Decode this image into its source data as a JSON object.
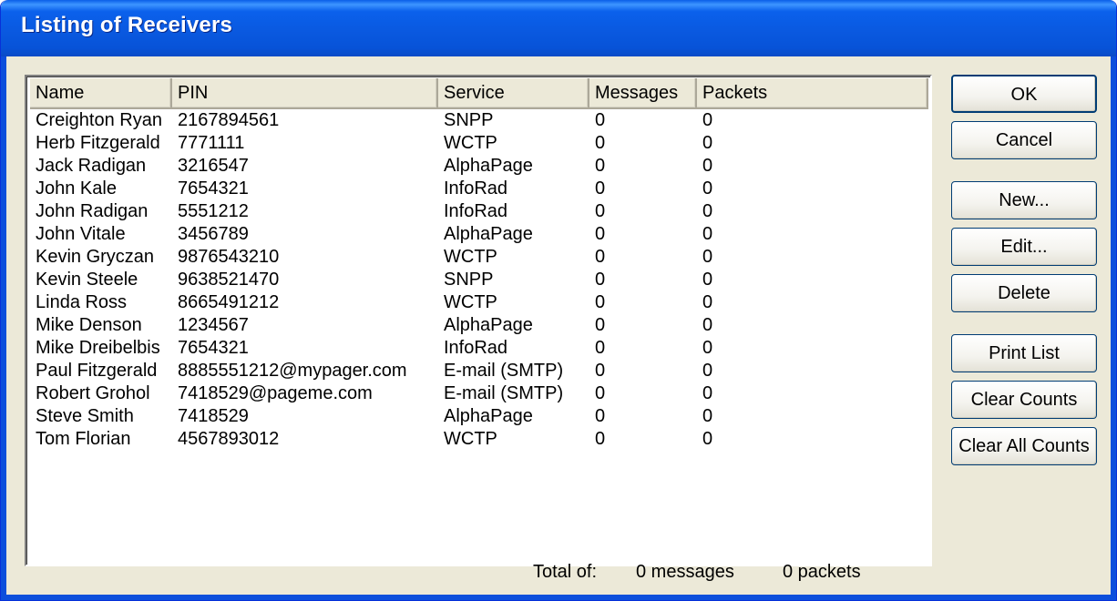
{
  "window": {
    "title": "Listing of Receivers"
  },
  "columns": [
    "Name",
    "PIN",
    "Service",
    "Messages",
    "Packets"
  ],
  "rows": [
    [
      "Creighton Ryan",
      "2167894561",
      "SNPP",
      "0",
      "0"
    ],
    [
      "Herb Fitzgerald",
      "7771111",
      "WCTP",
      "0",
      "0"
    ],
    [
      "Jack Radigan",
      "3216547",
      "AlphaPage",
      "0",
      "0"
    ],
    [
      "John Kale",
      "7654321",
      "InfoRad",
      "0",
      "0"
    ],
    [
      "John Radigan",
      "5551212",
      "InfoRad",
      "0",
      "0"
    ],
    [
      "John Vitale",
      "3456789",
      "AlphaPage",
      "0",
      "0"
    ],
    [
      "Kevin Gryczan",
      "9876543210",
      "WCTP",
      "0",
      "0"
    ],
    [
      "Kevin Steele",
      "9638521470",
      "SNPP",
      "0",
      "0"
    ],
    [
      "Linda Ross",
      "8665491212",
      "WCTP",
      "0",
      "0"
    ],
    [
      "Mike Denson",
      "1234567",
      "AlphaPage",
      "0",
      "0"
    ],
    [
      "Mike Dreibelbis",
      "7654321",
      "InfoRad",
      "0",
      "0"
    ],
    [
      "Paul Fitzgerald",
      "8885551212@mypager.com",
      "E-mail (SMTP)",
      "0",
      "0"
    ],
    [
      "Robert Grohol",
      "7418529@pageme.com",
      "E-mail (SMTP)",
      "0",
      "0"
    ],
    [
      "Steve Smith",
      "7418529",
      "AlphaPage",
      "0",
      "0"
    ],
    [
      "Tom Florian",
      "4567893012",
      "WCTP",
      "0",
      "0"
    ]
  ],
  "buttons": {
    "ok": "OK",
    "cancel": "Cancel",
    "new": "New...",
    "edit": "Edit...",
    "delete": "Delete",
    "print_list": "Print List",
    "clear_counts": "Clear Counts",
    "clear_all_counts": "Clear All Counts"
  },
  "footer": {
    "total_label": "Total of:",
    "messages": "0 messages",
    "packets": "0 packets"
  }
}
